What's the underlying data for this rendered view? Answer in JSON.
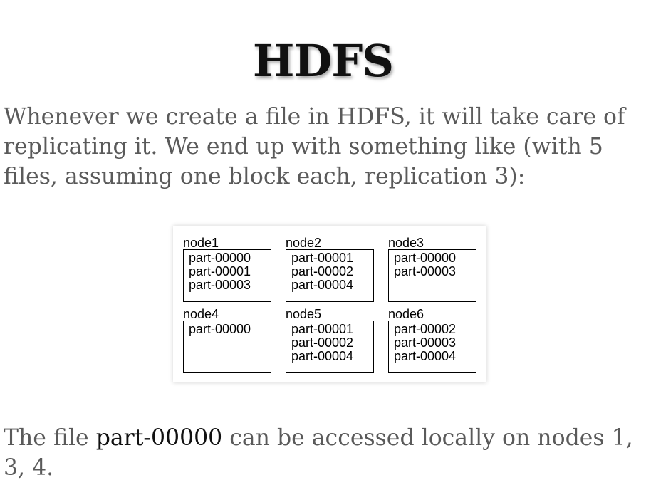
{
  "title": "HDFS",
  "intro_text": "Whenever we create a file in HDFS, it will take care of replicating it. We end up with something like (with 5 files, assuming one block each, replication 3):",
  "nodes": [
    {
      "label": "node1",
      "parts": [
        "part-00000",
        "part-00001",
        "part-00003"
      ]
    },
    {
      "label": "node2",
      "parts": [
        "part-00001",
        "part-00002",
        "part-00004"
      ]
    },
    {
      "label": "node3",
      "parts": [
        "part-00000",
        "part-00003",
        ""
      ]
    },
    {
      "label": "node4",
      "parts": [
        "part-00000",
        "",
        ""
      ]
    },
    {
      "label": "node5",
      "parts": [
        "part-00001",
        "part-00002",
        "part-00004"
      ]
    },
    {
      "label": "node6",
      "parts": [
        "part-00002",
        "part-00003",
        "part-00004"
      ]
    }
  ],
  "conclusion": {
    "prefix": "The file ",
    "file": "part-00000",
    "suffix": " can be accessed locally on nodes 1, 3, 4."
  }
}
